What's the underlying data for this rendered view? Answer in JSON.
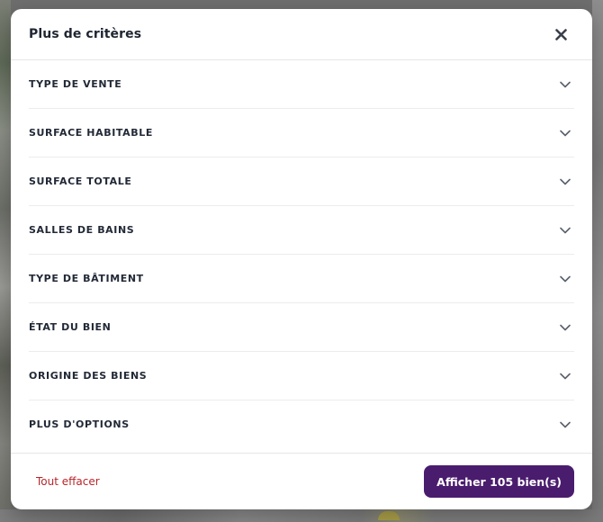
{
  "modal": {
    "title": "Plus de critères",
    "close_icon": "close-icon"
  },
  "criteria": [
    {
      "label": "TYPE DE VENTE",
      "icon": "chevron-down-icon"
    },
    {
      "label": "SURFACE HABITABLE",
      "icon": "chevron-down-icon"
    },
    {
      "label": "SURFACE TOTALE",
      "icon": "chevron-down-icon"
    },
    {
      "label": "SALLES DE BAINS",
      "icon": "chevron-down-icon"
    },
    {
      "label": "TYPE DE BÂTIMENT",
      "icon": "chevron-down-icon"
    },
    {
      "label": "ÉTAT DU BIEN",
      "icon": "chevron-down-icon"
    },
    {
      "label": "ORIGINE DES BIENS",
      "icon": "chevron-down-icon"
    },
    {
      "label": "PLUS D'OPTIONS",
      "icon": "chevron-down-icon"
    }
  ],
  "footer": {
    "clear_label": "Tout effacer",
    "submit_label": "Afficher 105 bien(s)"
  },
  "colors": {
    "accent": "#4a1c6e",
    "danger_link": "#b7252a",
    "text": "#222936"
  }
}
